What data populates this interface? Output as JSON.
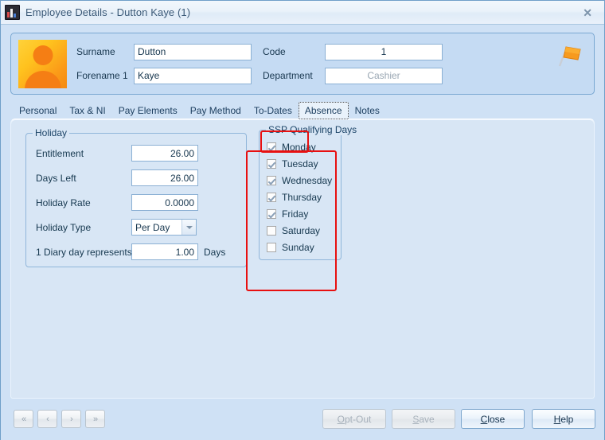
{
  "window": {
    "title": "Employee Details - Dutton Kaye (1)",
    "icon": "bar-chart-app-icon",
    "close_label": "✕"
  },
  "header": {
    "avatar_icon": "person-placeholder-avatar",
    "flag_icon": "orange-flag-icon",
    "fields": {
      "surname_label": "Surname",
      "surname_value": "Dutton",
      "forename_label": "Forename 1",
      "forename_value": "Kaye",
      "code_label": "Code",
      "code_value": "1",
      "department_label": "Department",
      "department_value": "Cashier"
    }
  },
  "tabs": [
    {
      "label": "Personal",
      "selected": false
    },
    {
      "label": "Tax & NI",
      "selected": false
    },
    {
      "label": "Pay Elements",
      "selected": false
    },
    {
      "label": "Pay Method",
      "selected": false
    },
    {
      "label": "To-Dates",
      "selected": false
    },
    {
      "label": "Absence",
      "selected": true
    },
    {
      "label": "Notes",
      "selected": false
    }
  ],
  "holiday": {
    "legend": "Holiday",
    "entitlement_label": "Entitlement",
    "entitlement_value": "26.00",
    "days_left_label": "Days Left",
    "days_left_value": "26.00",
    "holiday_rate_label": "Holiday Rate",
    "holiday_rate_value": "0.0000",
    "holiday_type_label": "Holiday Type",
    "holiday_type_value": "Per Day",
    "diary_label": "1 Diary day represents",
    "diary_value": "1.00",
    "diary_suffix": "Days"
  },
  "ssp": {
    "legend": "SSP Qualifying Days",
    "days": [
      {
        "label": "Monday",
        "checked": true
      },
      {
        "label": "Tuesday",
        "checked": true
      },
      {
        "label": "Wednesday",
        "checked": true
      },
      {
        "label": "Thursday",
        "checked": true
      },
      {
        "label": "Friday",
        "checked": true
      },
      {
        "label": "Saturday",
        "checked": false
      },
      {
        "label": "Sunday",
        "checked": false
      }
    ]
  },
  "footer": {
    "first_label": "«",
    "prev_label": "‹",
    "next_label": "›",
    "last_label": "»",
    "optout_label": "Opt-Out",
    "save_label": "Save",
    "close_label": "Close",
    "help_label": "Help"
  },
  "annotations": {
    "accent_color": "#e81010",
    "tab_highlight": "Absence",
    "group_highlight": "SSP Qualifying Days"
  }
}
